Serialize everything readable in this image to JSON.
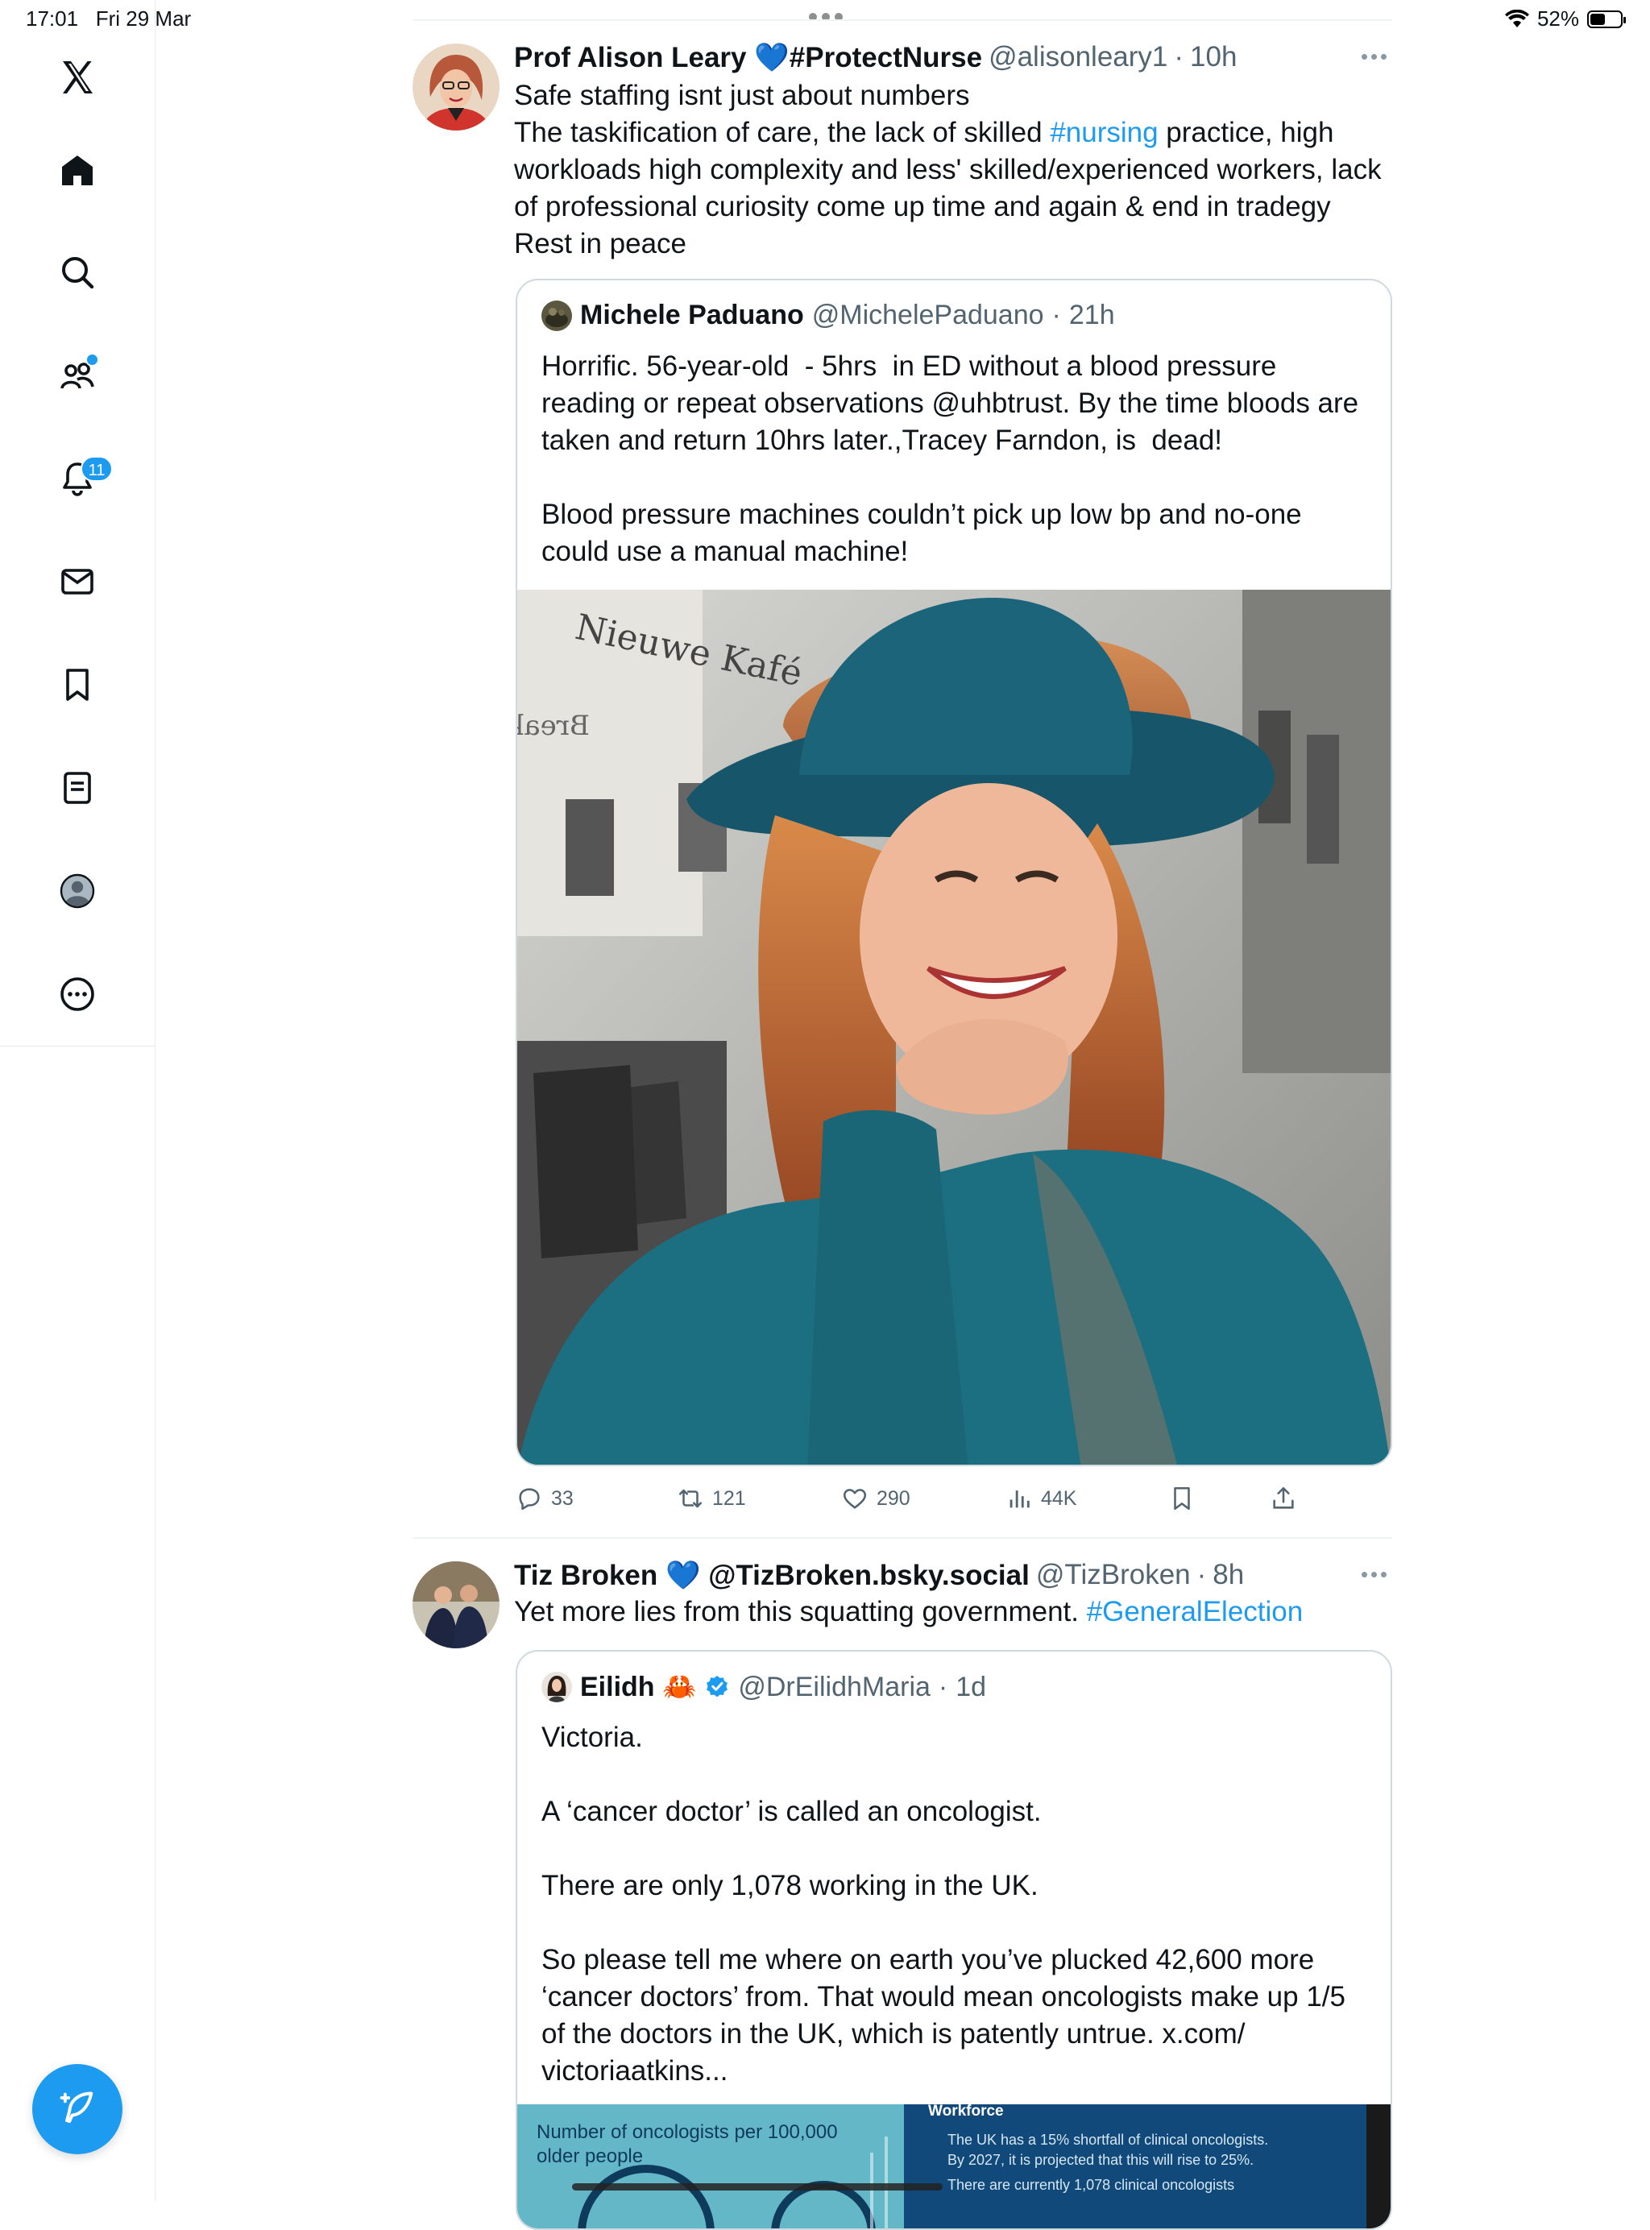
{
  "status_bar": {
    "time": "17:01",
    "date": "Fri 29 Mar",
    "battery": "52%"
  },
  "sidebar": {
    "items": [
      {
        "name": "x-logo"
      },
      {
        "name": "home"
      },
      {
        "name": "explore"
      },
      {
        "name": "communities"
      },
      {
        "name": "notifications",
        "badge": "11"
      },
      {
        "name": "messages"
      },
      {
        "name": "bookmarks"
      },
      {
        "name": "lists"
      },
      {
        "name": "profile"
      },
      {
        "name": "more"
      }
    ]
  },
  "tweets": [
    {
      "author": "Prof Alison Leary 💙#ProtectNurse",
      "handle": "@alisonleary1",
      "time": "10h",
      "text_pre": "Safe staffing isnt just about numbers\nThe taskification of care, the lack of skilled ",
      "hashtag": "#nursing",
      "text_post": " practice, high workloads high complexity and less' skilled/experienced workers, lack of professional curiosity come up time and again & end in tradegy\nRest in peace",
      "quote": {
        "author": "Michele Paduano",
        "handle": "@MichelePaduano",
        "time": "21h",
        "text": "Horrific. 56-year-old  - 5hrs  in ED without a blood pressure reading or repeat observations @uhbtrust. By the time bloods are taken and return 10hrs later.,Tracey Farndon, is  dead!\n\nBlood pressure machines couldn’t pick up low bp and no-one could use a manual machine!",
        "photo_sign_1": "Nieuwe Kafé",
        "photo_sign_2": "Break"
      },
      "stats": {
        "replies": "33",
        "retweets": "121",
        "likes": "290",
        "views": "44K"
      }
    },
    {
      "author": "Tiz Broken 💙 @TizBroken.bsky.social",
      "handle": "@TizBroken",
      "time": "8h",
      "text_pre": "Yet more lies from this squatting government. ",
      "hashtag": "#GeneralElection",
      "quote": {
        "author": "Eilidh 🦀",
        "handle": "@DrEilidhMaria",
        "time": "1d",
        "text": "Victoria.\n\nA ‘cancer doctor’ is called an oncologist.\n\nThere are only 1,078 working in the UK.\n\nSo please tell me where on earth you’ve plucked 42,600 more ‘cancer doctors’ from. That would mean oncologists make up 1/5 of the doctors in the UK, which is patently untrue. x.com/\nvictoriaatkins...",
        "infographic": {
          "left_title": "Number of oncologists per 100,000 older people",
          "right_title": "Workforce",
          "line1": "The UK has a 15% shortfall of clinical oncologists.",
          "line2": "By 2027, it is projected that this will rise to 25%.",
          "line3": "There are currently 1,078 clinical oncologists"
        }
      }
    }
  ],
  "colors": {
    "accent": "#1d9bf0",
    "text": "#0f1419",
    "muted": "#536471",
    "border": "#cfd9de"
  }
}
